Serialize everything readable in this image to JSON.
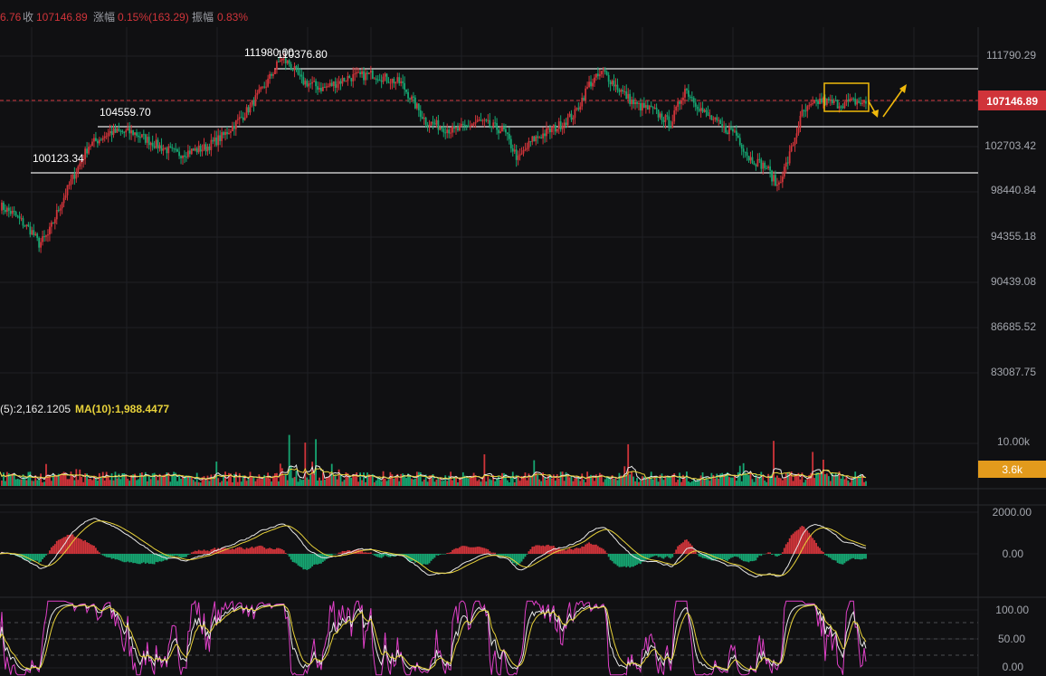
{
  "header": {
    "open_fragment": "6.76",
    "close_label": "收",
    "close_value": "107146.89",
    "change_label": "涨幅",
    "change_value": "0.15%(163.29)",
    "amplitude_label": "振幅",
    "amplitude_value": "0.83%"
  },
  "colors": {
    "background": "#101012",
    "grid": "#1f2024",
    "up": "#d0343a",
    "down": "#16a672",
    "ma_yellow": "#e8d23a",
    "line_white": "#e8e8e8",
    "kdj_pink": "#e040c8",
    "price_tag": "#d0343a",
    "volume_tag": "#e29a1c",
    "annotation_box": "#f0b90b",
    "arrow": "#f0b90b"
  },
  "price_panel": {
    "axis_ticks": [
      "111790.29",
      "102703.42",
      "98440.84",
      "94355.18",
      "90439.08",
      "86685.52",
      "83087.75"
    ],
    "current_price": "107146.89",
    "annotations": [
      {
        "text": "111980.00",
        "role": "high-label-back"
      },
      {
        "text": "110376.80",
        "role": "high-label"
      },
      {
        "text": "104559.70",
        "role": "support-1"
      },
      {
        "text": "100123.34",
        "role": "support-2"
      }
    ],
    "levels": {
      "resistance": 110376.8,
      "support_1": 104559.7,
      "support_2": 100123.34
    }
  },
  "volume_panel": {
    "ma5_label": "(5):2,162.1205",
    "ma10_label": "MA(10):1,988.4477",
    "axis_tick": "10.00k",
    "current_volume": "3.6k"
  },
  "macd_panel": {
    "axis_ticks": [
      "2000.00",
      "0.00"
    ]
  },
  "kdj_panel": {
    "axis_ticks": [
      "100.00",
      "50.00",
      "0.00"
    ]
  },
  "chart_data": {
    "type": "candlestick",
    "price_ylim": [
      80000,
      113500
    ],
    "anchors": [
      [
        0,
        97600
      ],
      [
        8,
        96800
      ],
      [
        18,
        95200
      ],
      [
        22,
        94100
      ],
      [
        27,
        94900
      ],
      [
        33,
        97300
      ],
      [
        40,
        99800
      ],
      [
        50,
        103100
      ],
      [
        62,
        104300
      ],
      [
        75,
        104300
      ],
      [
        90,
        103000
      ],
      [
        100,
        102300
      ],
      [
        116,
        102900
      ],
      [
        126,
        104000
      ],
      [
        138,
        106000
      ],
      [
        150,
        108700
      ],
      [
        158,
        111000
      ],
      [
        163,
        110600
      ],
      [
        170,
        109000
      ],
      [
        182,
        108300
      ],
      [
        196,
        109300
      ],
      [
        210,
        109600
      ],
      [
        226,
        108800
      ],
      [
        240,
        105300
      ],
      [
        256,
        104400
      ],
      [
        270,
        105300
      ],
      [
        284,
        104400
      ],
      [
        292,
        101800
      ],
      [
        300,
        103600
      ],
      [
        314,
        104800
      ],
      [
        324,
        106000
      ],
      [
        332,
        108700
      ],
      [
        340,
        109800
      ],
      [
        348,
        108400
      ],
      [
        358,
        106800
      ],
      [
        368,
        106300
      ],
      [
        378,
        105100
      ],
      [
        386,
        108300
      ],
      [
        396,
        106200
      ],
      [
        408,
        104600
      ],
      [
        414,
        104400
      ],
      [
        422,
        102000
      ],
      [
        432,
        101100
      ],
      [
        438,
        99400
      ],
      [
        444,
        101700
      ],
      [
        452,
        106000
      ],
      [
        462,
        107200
      ],
      [
        472,
        106900
      ],
      [
        482,
        107100
      ],
      [
        488,
        106900
      ]
    ],
    "volume_spikes": [
      [
        163,
        12000
      ],
      [
        172,
        10200
      ],
      [
        178,
        11000
      ],
      [
        354,
        9800
      ],
      [
        436,
        10600
      ],
      [
        458,
        8000
      ]
    ],
    "title": "",
    "xlabel": "",
    "ylabel": ""
  }
}
